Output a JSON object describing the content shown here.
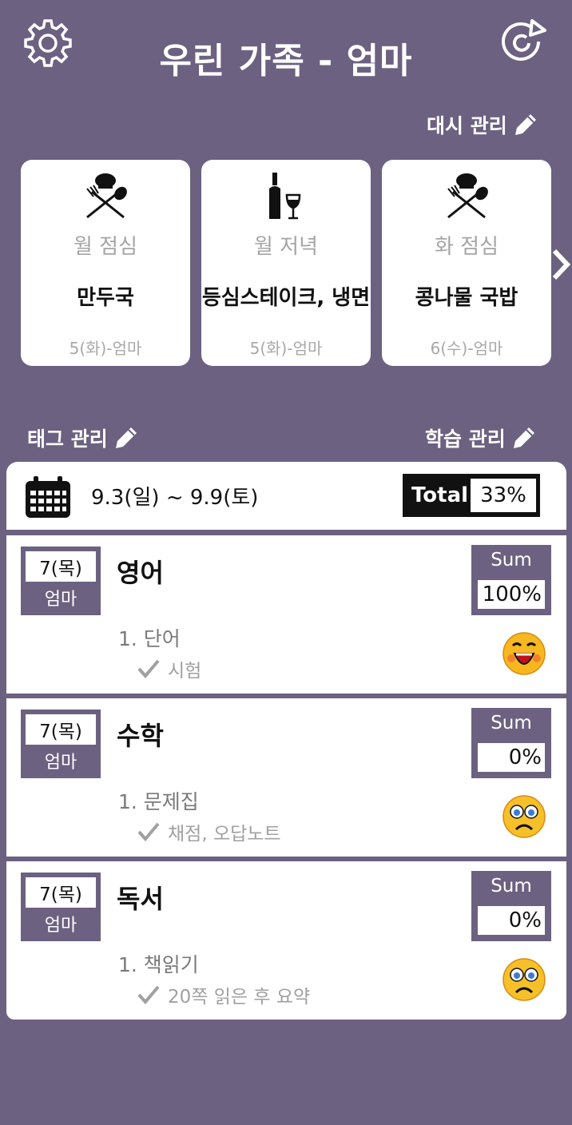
{
  "header": {
    "title": "우린 가족 - 엄마",
    "settings_icon": "gear-icon",
    "refresh_icon": "refresh-icon"
  },
  "meals": {
    "manage_label": "대시 관리",
    "cards": [
      {
        "icon": "chef-utensils-icon",
        "title": "월 점심",
        "menu": "만두국",
        "date": "5(화)-엄마"
      },
      {
        "icon": "wine-icon",
        "title": "월 저녁",
        "menu": "등심스테이크, 냉면",
        "date": "5(화)-엄마"
      },
      {
        "icon": "chef-utensils-icon",
        "title": "화 점심",
        "menu": "콩나물 국밥",
        "date": "6(수)-엄마"
      }
    ],
    "next_icon": "chevron-right-icon"
  },
  "tags_manage_label": "태그 관리",
  "study_manage_label": "학습 관리",
  "week": {
    "range": "9.3(일) ~ 9.9(토)",
    "total_label": "Total",
    "total_value": "33%",
    "icon": "calendar-icon"
  },
  "subjects": [
    {
      "day": "7(목)",
      "who": "엄마",
      "name": "영어",
      "sum_label": "Sum",
      "sum_value": "100%",
      "task": "1. 단어",
      "check": "시험",
      "emoji": "happy-face-icon"
    },
    {
      "day": "7(목)",
      "who": "엄마",
      "name": "수학",
      "sum_label": "Sum",
      "sum_value": "0%",
      "task": "1. 문제집",
      "check": "채점, 오답노트",
      "emoji": "sad-face-icon"
    },
    {
      "day": "7(목)",
      "who": "엄마",
      "name": "독서",
      "sum_label": "Sum",
      "sum_value": "0%",
      "task": "1. 책읽기",
      "check": "20쪽 읽은 후 요약",
      "emoji": "sad-face-icon"
    }
  ],
  "colors": {
    "background": "#6c6180",
    "card": "#ffffff",
    "accent_dark": "#111111"
  }
}
